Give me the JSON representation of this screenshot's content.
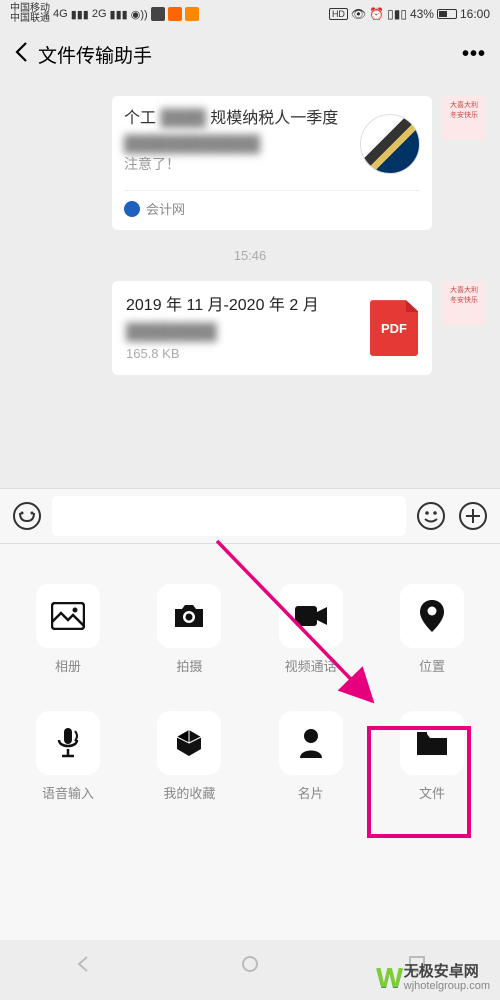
{
  "status": {
    "carrier1": "中国移动",
    "carrier2": "中国联通",
    "net1": "4G",
    "net2": "2G",
    "hd": "HD",
    "battery": "43%",
    "time": "16:00"
  },
  "header": {
    "title": "文件传输助手",
    "more": "•••"
  },
  "chat": {
    "article": {
      "title_fragment1": "个工",
      "title_fragment2": "规模纳税人一季度",
      "sub": "注意了！",
      "source": "会计网"
    },
    "timestamp": "15:46",
    "file": {
      "name_line1": "2019 年 11 月-2020 年 2 月",
      "type": "PDF",
      "size": "165.8 KB"
    }
  },
  "attach": {
    "row1": [
      {
        "label": "相册"
      },
      {
        "label": "拍摄"
      },
      {
        "label": "视频通话"
      },
      {
        "label": "位置"
      }
    ],
    "row2": [
      {
        "label": "语音输入"
      },
      {
        "label": "我的收藏"
      },
      {
        "label": "名片"
      },
      {
        "label": "文件"
      }
    ]
  },
  "watermark": {
    "name": "无极安卓网",
    "url": "wjhotelgroup.com"
  }
}
